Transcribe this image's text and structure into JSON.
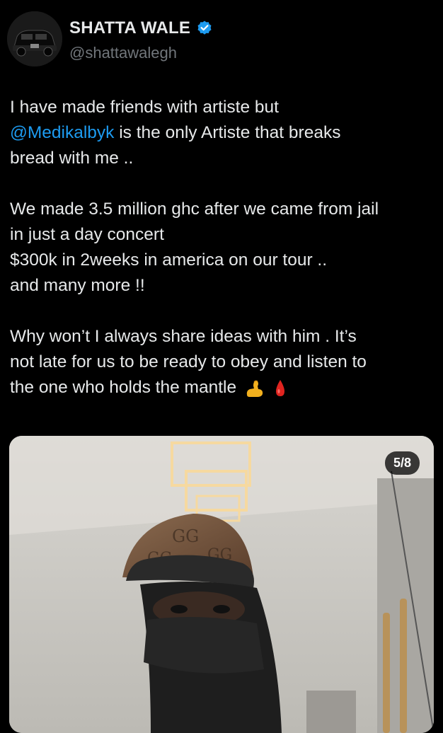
{
  "author": {
    "display_name": "SHATTA WALE",
    "handle": "@shattawalegh",
    "verified": true,
    "avatar_icon": "car-avatar-icon"
  },
  "tweet": {
    "line1": "I have made friends with artiste but",
    "mention": "@Medikalbyk",
    "line2_rest": " is the only Artiste that breaks",
    "line3": "bread with me ..",
    "para2_line1": "We made 3.5 million ghc after we came from jail",
    "para2_line2": "in just a day concert",
    "para2_line3": "$300k in 2weeks in america on our tour ..",
    "para2_line4": "and many more !!",
    "para3_line1": "Why won’t I always share ideas with him . It’s",
    "para3_line2": "not late for us to be ready to  obey and listen to",
    "para3_line3": "the one who holds the mantle",
    "emojis": [
      "flexed-biceps-icon",
      "drop-of-blood-icon"
    ]
  },
  "media": {
    "counter": "5/8"
  },
  "colors": {
    "background": "#000000",
    "text": "#e7e9ea",
    "secondary": "#71767b",
    "link": "#1d9bf0",
    "verified": "#1d9bf0"
  }
}
